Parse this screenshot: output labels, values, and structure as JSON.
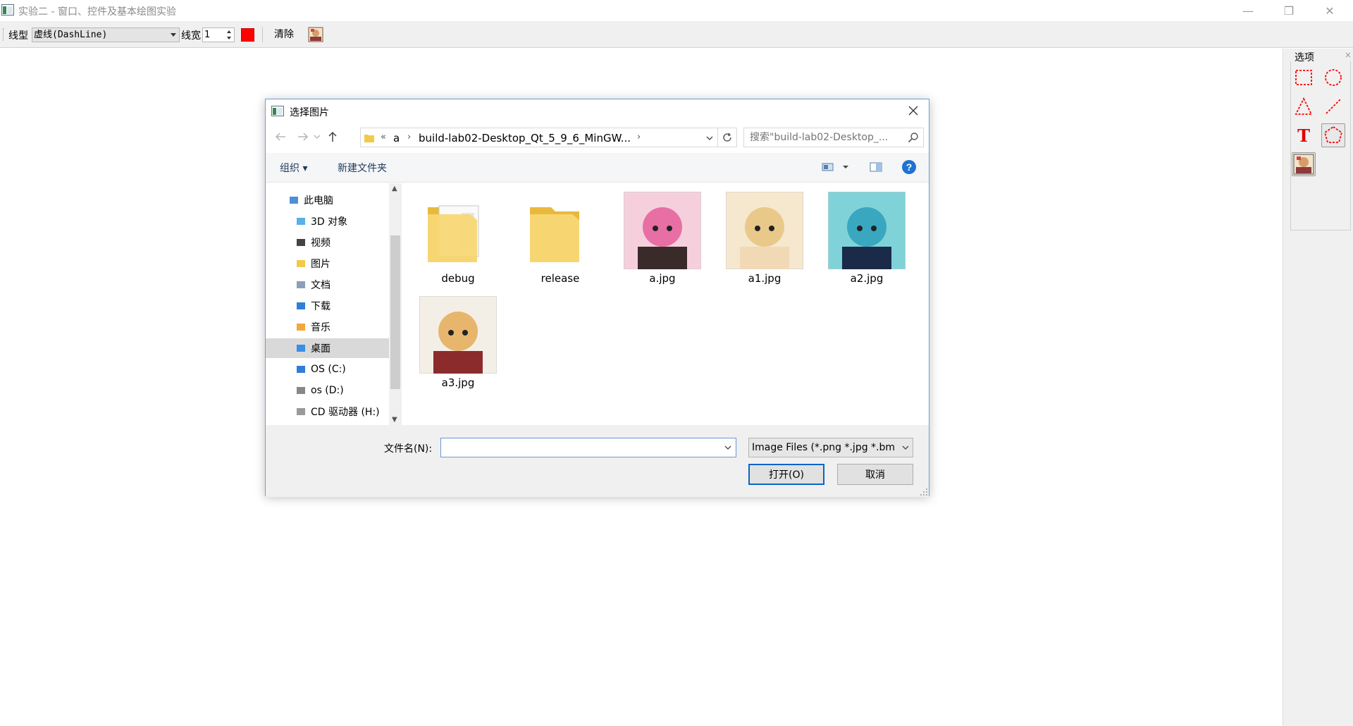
{
  "window": {
    "title": "实验二 - 窗口、控件及基本绘图实验",
    "minimize_glyph": "—",
    "maximize_glyph": "❐",
    "close_glyph": "✕"
  },
  "toolbar": {
    "line_type_label": "线型",
    "line_type_value": "虚线(DashLine)",
    "line_width_label": "线宽",
    "line_width_value": "1",
    "pen_color": "#ff0000",
    "clear_label": "清除",
    "insert_image_icon": "image-icon"
  },
  "dock": {
    "title": "选项",
    "tools": [
      {
        "name": "rectangle-tool",
        "icon": "dashed-rectangle-icon"
      },
      {
        "name": "ellipse-tool",
        "icon": "dashed-circle-icon"
      },
      {
        "name": "triangle-tool",
        "icon": "dashed-triangle-icon"
      },
      {
        "name": "line-tool",
        "icon": "dashed-line-icon"
      },
      {
        "name": "text-tool",
        "icon": "text-icon",
        "glyph": "T"
      },
      {
        "name": "polygon-tool",
        "icon": "dashed-diamond-icon",
        "active": true
      },
      {
        "name": "image-tool",
        "icon": "image-icon"
      }
    ],
    "accent_color": "#ff0000"
  },
  "dialog": {
    "title": "选择图片",
    "address": {
      "overflow": "«",
      "segments": [
        "a",
        "build-lab02-Desktop_Qt_5_9_6_MinGW..."
      ]
    },
    "search_placeholder": "搜索\"build-lab02-Desktop_...",
    "commands": {
      "organize": "组织 ▾",
      "new_folder": "新建文件夹"
    },
    "nav": [
      {
        "label": "此电脑",
        "icon": "computer-icon",
        "indent": 0
      },
      {
        "label": "3D 对象",
        "icon": "3d-objects-icon",
        "indent": 1
      },
      {
        "label": "视频",
        "icon": "videos-icon",
        "indent": 1
      },
      {
        "label": "图片",
        "icon": "pictures-icon",
        "indent": 1
      },
      {
        "label": "文档",
        "icon": "documents-icon",
        "indent": 1
      },
      {
        "label": "下载",
        "icon": "downloads-icon",
        "indent": 1
      },
      {
        "label": "音乐",
        "icon": "music-icon",
        "indent": 1
      },
      {
        "label": "桌面",
        "icon": "desktop-icon",
        "indent": 1,
        "selected": true
      },
      {
        "label": "OS (C:)",
        "icon": "drive-c-icon",
        "indent": 1
      },
      {
        "label": "os (D:)",
        "icon": "drive-icon",
        "indent": 1
      },
      {
        "label": "CD 驱动器 (H:)",
        "icon": "cd-drive-icon",
        "indent": 1
      }
    ],
    "files": [
      {
        "name": "debug",
        "kind": "folder-with-docs"
      },
      {
        "name": "release",
        "kind": "folder"
      },
      {
        "name": "a.jpg",
        "kind": "image",
        "palette": [
          "#f5d0dc",
          "#e86fa3",
          "#3a2a2a"
        ]
      },
      {
        "name": "a1.jpg",
        "kind": "image",
        "palette": [
          "#f6e7cf",
          "#e9c98a",
          "#f2d9b6"
        ]
      },
      {
        "name": "a2.jpg",
        "kind": "image",
        "palette": [
          "#7fd3d8",
          "#3aa7c0",
          "#1b2a48"
        ]
      },
      {
        "name": "a3.jpg",
        "kind": "image",
        "palette": [
          "#f4efe6",
          "#e8b56d",
          "#8c2b2b"
        ]
      }
    ],
    "filename_label": "文件名(N):",
    "filename_value": "",
    "filter_value": "Image Files (*.png *.jpg *.bm",
    "open_button": "打开(O)",
    "cancel_button": "取消"
  }
}
